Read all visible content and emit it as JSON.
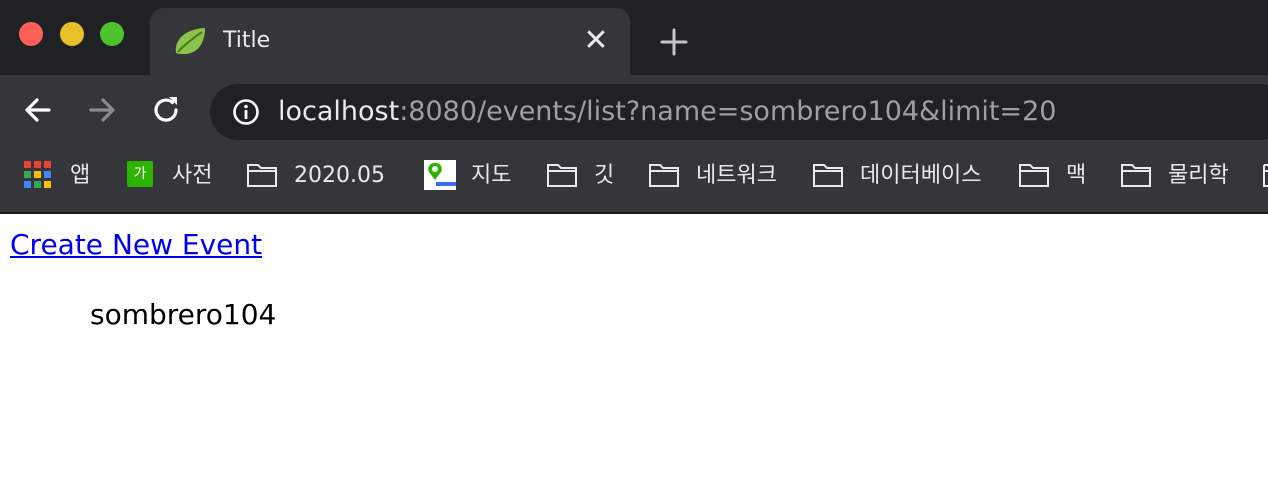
{
  "browser": {
    "tab": {
      "title": "Title",
      "favicon": "spring-leaf-icon",
      "close_glyph": "✕"
    },
    "address": {
      "host": "localhost",
      "rest": ":8080/events/list?name=sombrero104&limit=20"
    },
    "bookmarks": [
      {
        "label": "앱",
        "icon": "apps-grid-icon"
      },
      {
        "label": "사전",
        "icon": "dictionary-icon"
      },
      {
        "label": "2020.05",
        "icon": "folder-icon"
      },
      {
        "label": "지도",
        "icon": "map-icon"
      },
      {
        "label": "깃",
        "icon": "folder-icon"
      },
      {
        "label": "네트워크",
        "icon": "folder-icon"
      },
      {
        "label": "데이터베이스",
        "icon": "folder-icon"
      },
      {
        "label": "맥",
        "icon": "folder-icon"
      },
      {
        "label": "물리학",
        "icon": "folder-icon"
      }
    ],
    "dictionary_badge": "가",
    "colors": {
      "chrome_dark": "#202124",
      "chrome_mid": "#35363a",
      "link": "#0000ee"
    }
  },
  "page": {
    "create_link": "Create New Event",
    "events": [
      "sombrero104"
    ]
  }
}
